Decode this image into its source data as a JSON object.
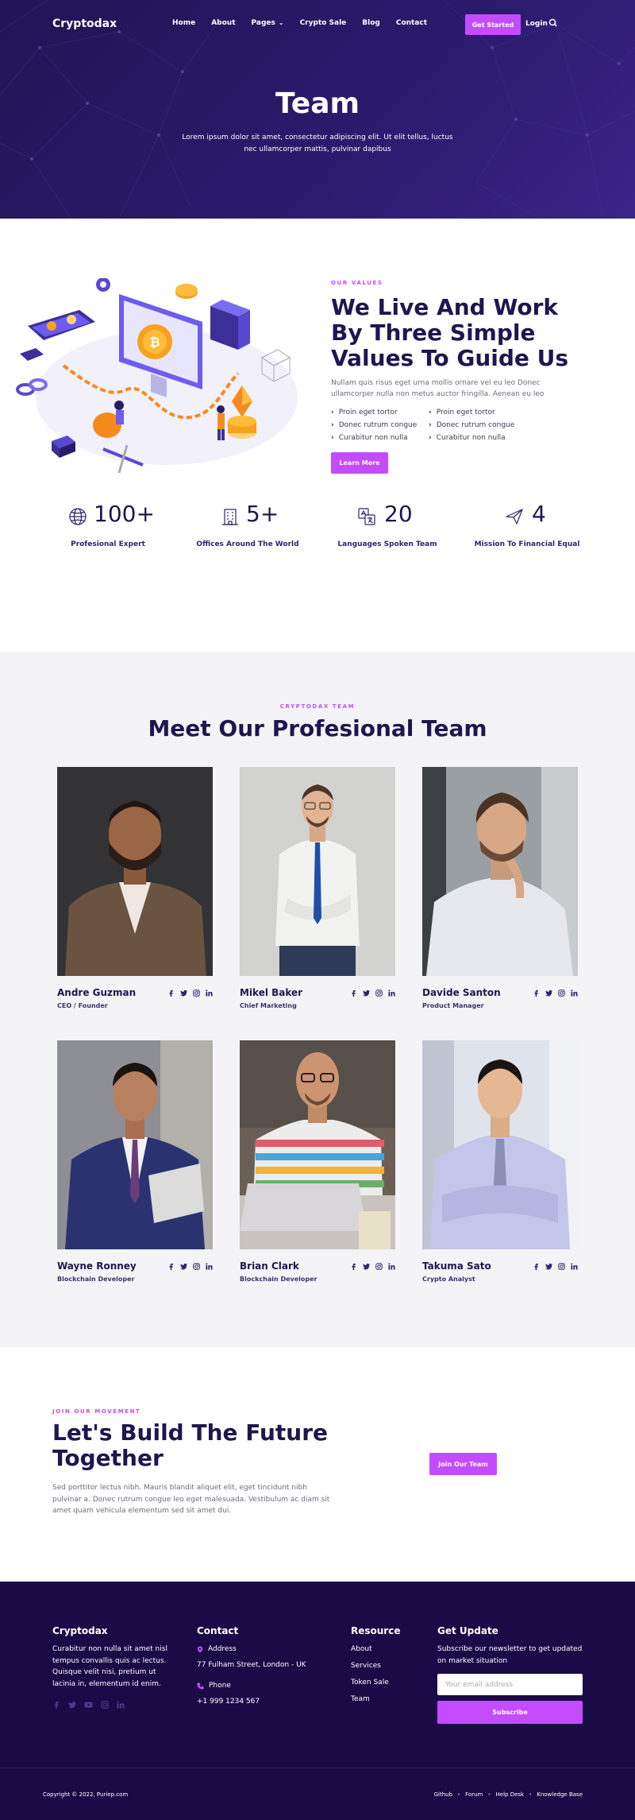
{
  "nav": {
    "logo": "Cryptodax",
    "links": [
      "Home",
      "About",
      "Pages",
      "Crypto Sale",
      "Blog",
      "Contact"
    ],
    "cta": "Get Started",
    "login": "Login"
  },
  "hero": {
    "title": "Team",
    "subtitle": "Lorem ipsum dolor sit amet, consectetur adipiscing elit. Ut elit tellus, luctus nec ullamcorper mattis, pulvinar dapibus"
  },
  "values": {
    "eyebrow": "OUR VALUES",
    "title": "We Live And Work By Three Simple Values To Guide Us",
    "text": "Nullam quis risus eget urna mollis ornare vel eu leo Donec ullamcorper nulla non metus auctor fringilla. Aenean eu leo",
    "list": [
      "Proin eget tortor",
      "Proin eget tortor",
      "Donec rutrum congue",
      "Donec rutrum congue",
      "Curabitur non nulla",
      "Curabitur non nulla"
    ],
    "button": "Learn More"
  },
  "stats": [
    {
      "icon": "globe-icon",
      "value": "100+",
      "label": "Profesional Expert"
    },
    {
      "icon": "building-icon",
      "value": "5+",
      "label": "Offices Around The World"
    },
    {
      "icon": "translate-icon",
      "value": "20",
      "label": "Languages Spoken Team"
    },
    {
      "icon": "paper-plane-icon",
      "value": "4",
      "label": "Mission To Financial Equal"
    }
  ],
  "team": {
    "eyebrow": "CRYPTODAX TEAM",
    "title": "Meet Our Profesional Team",
    "members": [
      {
        "name": "Andre Guzman",
        "role": "CEO / Founder"
      },
      {
        "name": "Mikel Baker",
        "role": "Chief Marketing"
      },
      {
        "name": "Davide Santon",
        "role": "Product Manager"
      },
      {
        "name": "Wayne Ronney",
        "role": "Blockchain Developer"
      },
      {
        "name": "Brian Clark",
        "role": "Blockchain Developer"
      },
      {
        "name": "Takuma Sato",
        "role": "Crypto Analyst"
      }
    ]
  },
  "cta": {
    "eyebrow": "JOIN OUR MOVEMENT",
    "title": "Let's Build The Future Together",
    "text": "Sed porttitor lectus nibh. Mauris blandit aliquet elit, eget tincidunt nibh pulvinar a. Donec rutrum congue leo eget malesuada. Vestibulum ac diam sit amet quam vehicula elementum sed sit amet dui.",
    "button": "Join Our Team"
  },
  "footer": {
    "brand": "Cryptodax",
    "about": "Curabitur non nulla sit amet nisl tempus convallis quis ac lectus. Quisque velit nisi, pretium ut lacinia in, elementum id enim.",
    "contact_title": "Contact",
    "address_label": "Address",
    "address": "77 Fulham Street, London - UK",
    "phone_label": "Phone",
    "phone": "+1 999 1234 567",
    "resource_title": "Resource",
    "resources": [
      "About",
      "Services",
      "Token Sale",
      "Team"
    ],
    "update_title": "Get Update",
    "update_text": "Subscribe our newsletter to get updated on market situation",
    "email_placeholder": "Your email address",
    "subscribe": "Subscribe",
    "copyright": "Copyright © 2022, Puriep.com",
    "bottom_links": [
      "Github",
      "Forum",
      "Help Desk",
      "Knowledge Base"
    ]
  },
  "colors": {
    "accent": "#c44cff",
    "navy": "#1e1650",
    "hero": "#221456",
    "footer": "#1a0b47",
    "team_bg": "#f4f4f6"
  }
}
